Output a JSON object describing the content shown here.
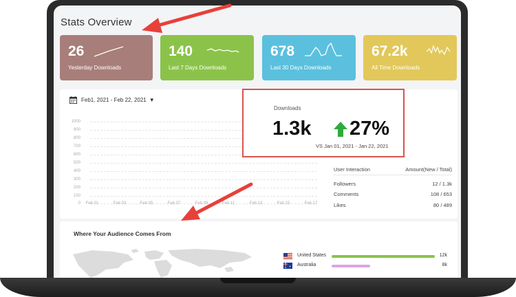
{
  "title": "Stats Overview",
  "stats": [
    {
      "value": "26",
      "label": "Yesterday Downloads",
      "color": "#a87e7a"
    },
    {
      "value": "140",
      "label": "Last 7 Days Downloads",
      "color": "#8bc34a"
    },
    {
      "value": "678",
      "label": "Last 30 Days Downloads",
      "color": "#5bc0de"
    },
    {
      "value": "67.2k",
      "label": "All Time Downloads",
      "color": "#e2c85a"
    }
  ],
  "chart": {
    "date_range": "Feb1, 2021 - Feb 22, 2021",
    "y_ticks": [
      "1000",
      "900",
      "800",
      "700",
      "600",
      "500",
      "400",
      "300",
      "200",
      "100",
      "0"
    ],
    "x_ticks": [
      "Feb 01",
      "Feb 03",
      "Feb 05",
      "Feb 07",
      "Feb 09",
      "Feb 11",
      "Feb 13",
      "Feb 15",
      "Feb 17"
    ]
  },
  "downloads": {
    "label": "Downloads",
    "value": "1.3k",
    "change": "27%",
    "comparison": "VS Jan 01, 2021 - Jan 22, 2021",
    "up_color": "#2eaa3e",
    "highlight_color": "#d9534f"
  },
  "interaction": {
    "header_left": "User Interaction",
    "header_right": "Amount(New / Total)",
    "rows": [
      {
        "name": "Followers",
        "amount": "12 / 1.3k"
      },
      {
        "name": "Comments",
        "amount": "108 / 653"
      },
      {
        "name": "Likes",
        "amount": "80 / 489"
      }
    ]
  },
  "audience": {
    "title": "Where Your Audience Comes From",
    "countries": [
      {
        "name": "United States",
        "value": "12k",
        "share": 1.0,
        "color": "#8bc34a"
      },
      {
        "name": "Australia",
        "value": "8k",
        "share": 0.36,
        "color": "#d8a6e8"
      }
    ]
  },
  "annotation_arrow_color": "#e8403a"
}
